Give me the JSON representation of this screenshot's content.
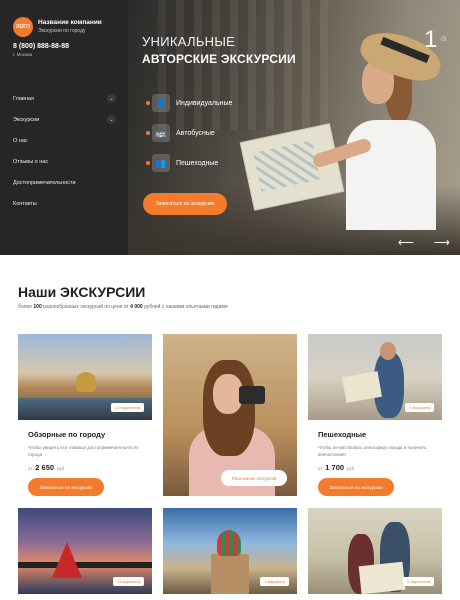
{
  "sidebar": {
    "logo": "ЛОГО",
    "company_name": "Название компании",
    "company_sub": "Экскурсии по городу",
    "phone": "8 (800) 888-88-88",
    "city": "г. Москва",
    "nav": [
      {
        "label": "Главная",
        "has_submenu": true
      },
      {
        "label": "Экскурсии",
        "has_submenu": true
      },
      {
        "label": "О нас",
        "has_submenu": false
      },
      {
        "label": "Отзывы о нас",
        "has_submenu": false
      },
      {
        "label": "Достопримечательности",
        "has_submenu": false
      },
      {
        "label": "Контакты",
        "has_submenu": false
      }
    ],
    "chevron_glyph": "⌄"
  },
  "hero": {
    "title_line1": "УНИКАЛЬНЫЕ",
    "title_line2": "АВТОРСКИЕ ЭКСКУРСИИ",
    "slide_current": "1",
    "slide_total": "/3",
    "features": [
      {
        "label": "Индивидуальные",
        "icon": "person-icon",
        "glyph": "👤"
      },
      {
        "label": "Автобусные",
        "icon": "bus-icon",
        "glyph": "🚌"
      },
      {
        "label": "Пешеходные",
        "icon": "walking-group-icon",
        "glyph": "👥"
      }
    ],
    "cta": "Записаться на экскурсию",
    "prev_glyph": "⟵",
    "next_glyph": "⟶",
    "accent_color": "#f37b2d"
  },
  "excursions": {
    "title": "Наши ЭКСКУРСИИ",
    "sub_prefix": "более",
    "sub_count": "100",
    "sub_mid": "разнообразных экскурсий по цене от",
    "sub_price": "4 000",
    "sub_suffix": "рублей с нашими опытными гидами",
    "cards": [
      {
        "badge": "12 вариантов",
        "title": "Обзорные по городу",
        "desc": "Чтобы увидеть все главные достопримечательности города",
        "price_from": "от",
        "price": "2 650",
        "currency": "руб",
        "button": "Записаться на экскурсию"
      },
      {
        "overlay_button": "Расписание экскурсий"
      },
      {
        "badge": "4 варианта",
        "title": "Пешеходные",
        "desc": "Чтобы почувствовать атмосферу города и получить впечатления!",
        "price_from": "от",
        "price": "1 700",
        "currency": "руб",
        "button": "Записаться на экскурсию"
      },
      {
        "badge": "24 варианта"
      },
      {
        "badge": "4 варианта"
      },
      {
        "badge": "6 вариантов"
      }
    ]
  }
}
